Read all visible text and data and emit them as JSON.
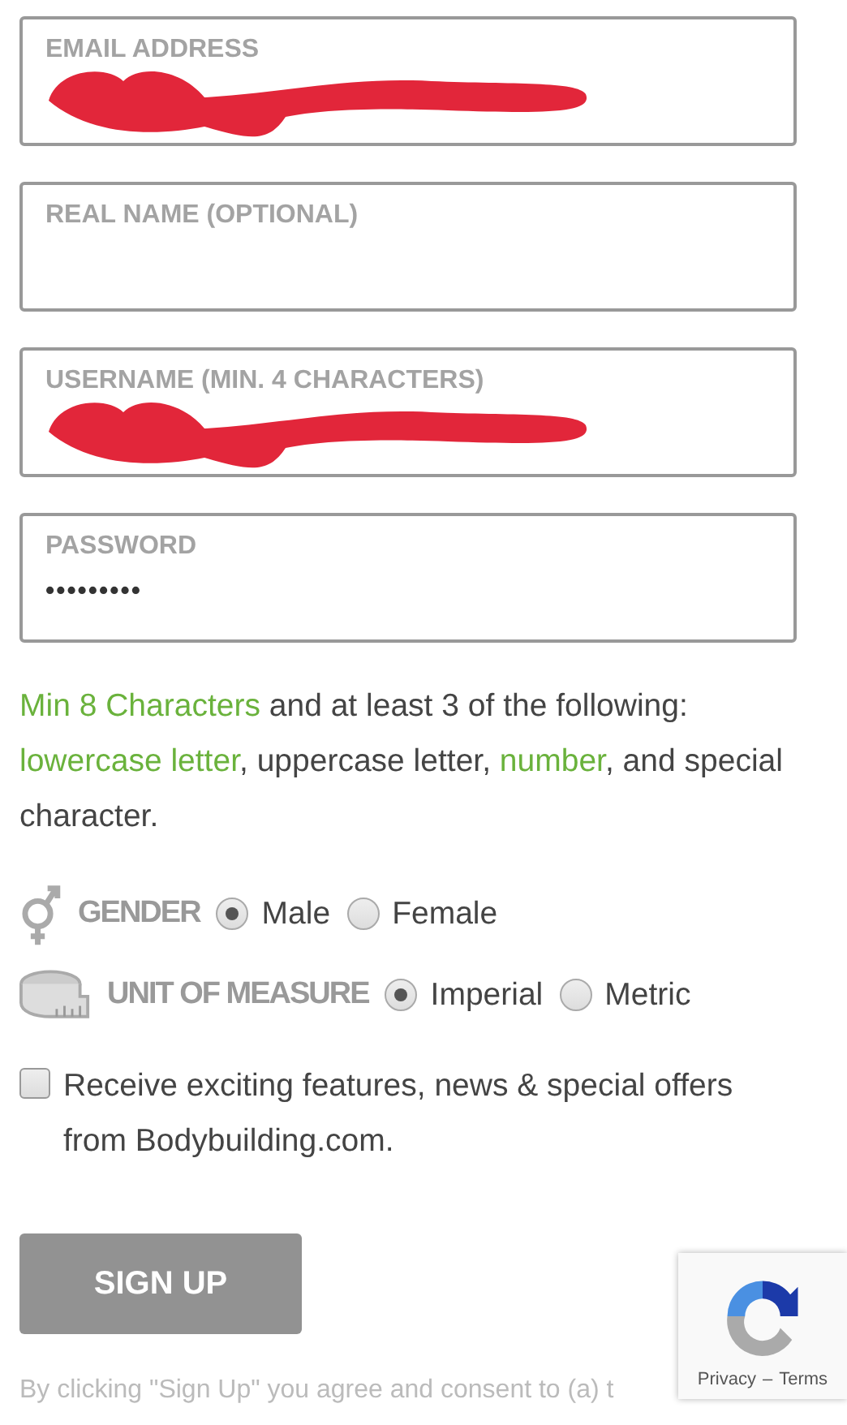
{
  "fields": [
    {
      "label": "EMAIL ADDRESS",
      "redacted": true
    },
    {
      "label": "REAL NAME (OPTIONAL)",
      "redacted": false
    },
    {
      "label": "USERNAME (MIN. 4 CHARACTERS)",
      "redacted": true
    },
    {
      "label": "PASSWORD",
      "value": "•••••••••",
      "redacted": false
    }
  ],
  "password_hint": [
    {
      "text": "Min 8 Characters",
      "highlight": true
    },
    {
      "text": " and at least 3 of the following: ",
      "highlight": false
    },
    {
      "text": "lowercase letter",
      "highlight": true
    },
    {
      "text": ", uppercase letter, ",
      "highlight": false
    },
    {
      "text": "number",
      "highlight": true
    },
    {
      "text": ", and special character.",
      "highlight": false
    }
  ],
  "options": [
    {
      "kind": "gender",
      "label": "GENDER",
      "choices": [
        {
          "label": "Male",
          "selected": true
        },
        {
          "label": "Female",
          "selected": false
        }
      ]
    },
    {
      "kind": "measure",
      "label": "UNIT OF MEASURE",
      "choices": [
        {
          "label": "Imperial",
          "selected": true
        },
        {
          "label": "Metric",
          "selected": false
        }
      ]
    }
  ],
  "newsletter": {
    "checked": false,
    "label": "Receive exciting features, news & special offers from Bodybuilding.com."
  },
  "submit": "SIGN UP",
  "disclaimer": "By clicking \"Sign Up\" you agree and consent to (a) t",
  "recaptcha": {
    "links": [
      "Privacy",
      "Terms"
    ],
    "separator": "–"
  }
}
